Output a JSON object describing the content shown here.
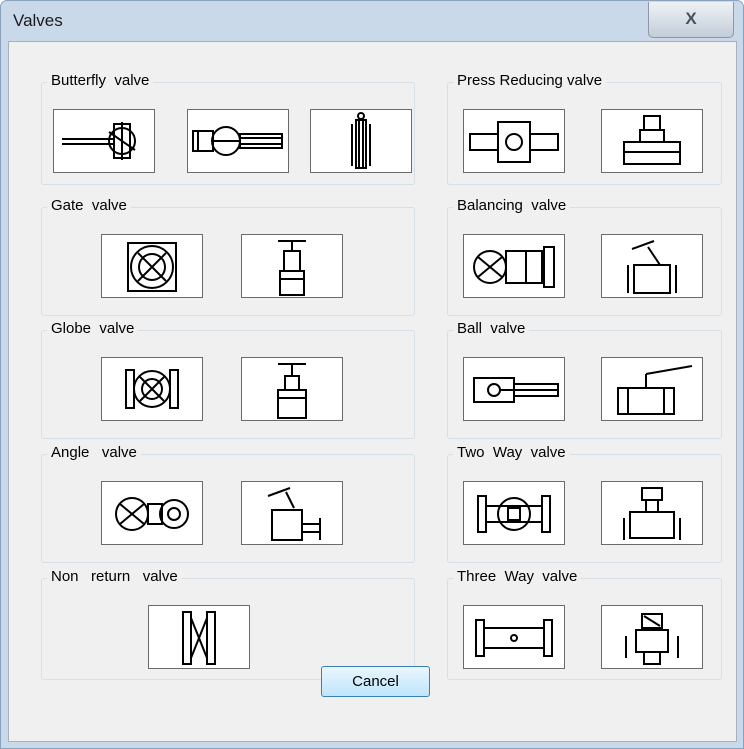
{
  "window": {
    "title": "Valves",
    "close_glyph": "X"
  },
  "groups": {
    "butterfly": {
      "label": "Butterfly  valve"
    },
    "gate": {
      "label": "Gate  valve"
    },
    "globe": {
      "label": "Globe  valve"
    },
    "angle": {
      "label": "Angle   valve"
    },
    "non_return": {
      "label": "Non   return   valve"
    },
    "press_reducing": {
      "label": "Press Reducing valve"
    },
    "balancing": {
      "label": "Balancing  valve"
    },
    "ball": {
      "label": "Ball  valve"
    },
    "two_way": {
      "label": "Two  Way  valve"
    },
    "three_way": {
      "label": "Three  Way  valve"
    }
  },
  "footer": {
    "cancel_label": "Cancel"
  },
  "colors": {
    "title_bar": "#c9d9ea",
    "dialog_bg": "#f0f0f0",
    "button_border": "#3c7fb1"
  }
}
